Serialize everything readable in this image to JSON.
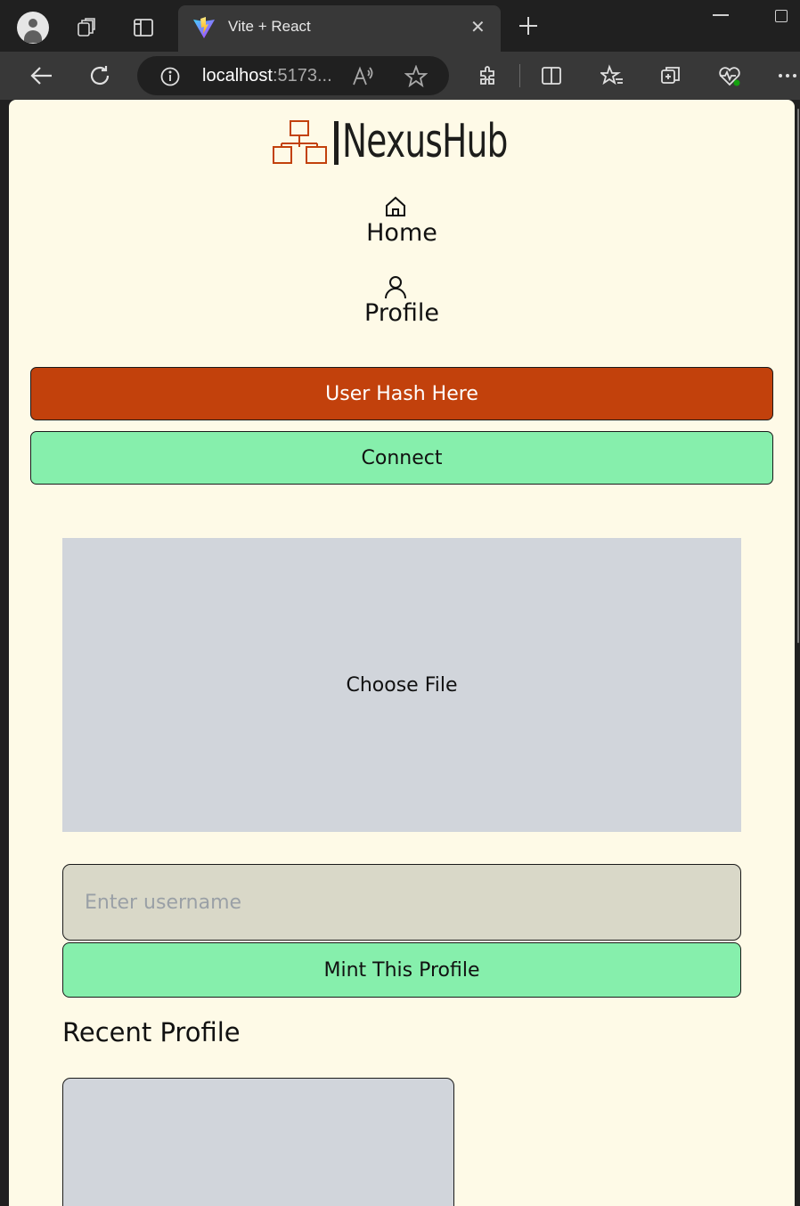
{
  "browser": {
    "tab_title": "Vite + React",
    "address_host": "localhost",
    "address_rest": ":5173..."
  },
  "app": {
    "brand": "NexusHub",
    "accent_color": "#c2410c",
    "success_color": "#86efac",
    "page_bg": "#fefae7"
  },
  "nav": [
    {
      "label": "Home",
      "icon": "home-icon"
    },
    {
      "label": "Profile",
      "icon": "user-icon"
    }
  ],
  "actions": {
    "user_hash_label": "User Hash Here",
    "connect_label": "Connect"
  },
  "form": {
    "file_label": "Choose File",
    "username_placeholder": "Enter username",
    "username_value": "",
    "mint_label": "Mint This Profile"
  },
  "recent": {
    "title": "Recent Profile"
  }
}
